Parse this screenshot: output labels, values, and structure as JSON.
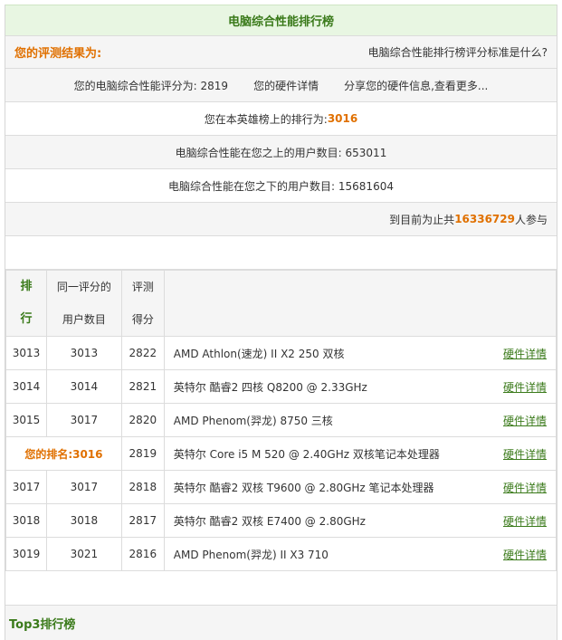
{
  "header": {
    "title": "电脑综合性能排行榜"
  },
  "result": {
    "label": "您的评测结果为:",
    "question": "电脑综合性能排行榜评分标准是什么?"
  },
  "score": {
    "text": "您的电脑综合性能评分为: 2819",
    "hw": "您的硬件详情",
    "share": "分享您的硬件信息,查看更多..."
  },
  "rank": {
    "prefix": "您在本英雄榜上的排行为:",
    "value": "3016"
  },
  "above": {
    "text": "电脑综合性能在您之上的用户数目: 653011"
  },
  "below": {
    "text": "电脑综合性能在您之下的用户数目: 15681604"
  },
  "total": {
    "prefix": "到目前为止共",
    "value": "16336729",
    "suffix": "人参与"
  },
  "table": {
    "head_rank": "排行",
    "head_users": "同一评分的用户数目",
    "head_score": "评测得分",
    "rows": [
      {
        "rank": "3013",
        "users": "3013",
        "score": "2822",
        "name": "AMD Athlon(速龙) II X2 250 双核",
        "link": "硬件详情"
      },
      {
        "rank": "3014",
        "users": "3014",
        "score": "2821",
        "name": "英特尔 酷睿2 四核 Q8200 @ 2.33GHz",
        "link": "硬件详情"
      },
      {
        "rank": "3015",
        "users": "3017",
        "score": "2820",
        "name": "AMD Phenom(羿龙) 8750 三核",
        "link": "硬件详情"
      },
      {
        "rank": "您的排名:3016",
        "users": "",
        "score": "2819",
        "name": "英特尔 Core i5 M 520 @ 2.40GHz 双核笔记本处理器",
        "link": "硬件详情"
      },
      {
        "rank": "3017",
        "users": "3017",
        "score": "2818",
        "name": "英特尔 酷睿2 双核 T9600 @ 2.80GHz 笔记本处理器",
        "link": "硬件详情"
      },
      {
        "rank": "3018",
        "users": "3018",
        "score": "2817",
        "name": "英特尔 酷睿2 双核 E7400 @ 2.80GHz",
        "link": "硬件详情"
      },
      {
        "rank": "3019",
        "users": "3021",
        "score": "2816",
        "name": "AMD Phenom(羿龙) II X3 710",
        "link": "硬件详情"
      }
    ]
  },
  "next_section": "Top3排行榜"
}
